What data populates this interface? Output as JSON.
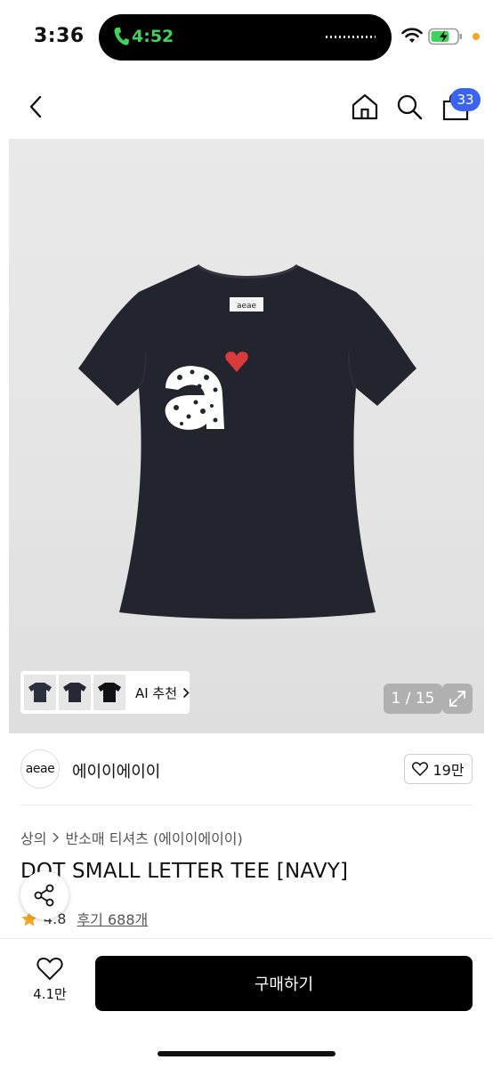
{
  "status_bar": {
    "time": "3:36",
    "call_time": "4:52"
  },
  "nav": {
    "cart_count": "33"
  },
  "hero": {
    "tee_label_text": "aeae",
    "ai_recommend_label": "AI 추천",
    "page_indicator": "1 / 15"
  },
  "brand": {
    "logo_text": "aeae",
    "name": "에이이에이이",
    "like_count": "19만"
  },
  "breadcrumb": {
    "category": "상의",
    "subcategory": "반소매 티셔츠 (에이이에이이)"
  },
  "product": {
    "title": "DOT SMALL LETTER TEE [NAVY]",
    "rating": "4.8",
    "reviews": "후기 688개"
  },
  "bottom": {
    "wish_count": "4.1만",
    "buy_label": "구매하기"
  },
  "colors": {
    "accent_badge": "#3b63f2",
    "call_green": "#3fd25c",
    "tee_navy": "#22252d",
    "heart_red": "#d93a3a",
    "star": "#f5a623"
  }
}
